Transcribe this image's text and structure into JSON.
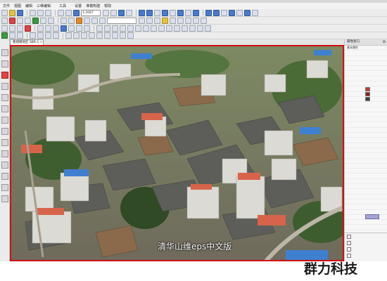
{
  "menu": [
    "文件",
    "视图",
    "编辑",
    "三维编辑",
    "",
    "工具",
    "",
    "设置",
    "准模构建",
    "帮助"
  ],
  "toolbar1": {
    "scale_value": "1:2087"
  },
  "doc_tab": {
    "label": "看建模地区 SBR-1"
  },
  "viewport": {
    "caption": "清华山维eps中文版"
  },
  "panel": {
    "title": "属性窗口",
    "rows": [
      {
        "key": "基本属性",
        "value": ""
      },
      {
        "key": "",
        "value": ""
      },
      {
        "key": "",
        "value": ""
      },
      {
        "key": "",
        "value": ""
      },
      {
        "key": "",
        "value": ""
      },
      {
        "key": "",
        "value": ""
      },
      {
        "key": "",
        "value": ""
      },
      {
        "key": "",
        "value": ""
      },
      {
        "key": "",
        "value": ""
      },
      {
        "key": "",
        "value": ""
      },
      {
        "key": "",
        "value": ""
      },
      {
        "key": "",
        "value": ""
      },
      {
        "key": "",
        "value": ""
      },
      {
        "key": "",
        "value": ""
      },
      {
        "key": "",
        "value": ""
      },
      {
        "key": "",
        "value": ""
      },
      {
        "key": "",
        "value": ""
      },
      {
        "key": "",
        "value": ""
      },
      {
        "key": "",
        "value": ""
      },
      {
        "key": "",
        "value": ""
      },
      {
        "key": "",
        "value": ""
      },
      {
        "key": "",
        "value": ""
      },
      {
        "key": "",
        "value": ""
      },
      {
        "key": "",
        "value": ""
      },
      {
        "key": "",
        "value": ""
      },
      {
        "key": "",
        "value": ""
      },
      {
        "key": "",
        "value": ""
      },
      {
        "key": "",
        "value": ""
      },
      {
        "key": "",
        "value": ""
      },
      {
        "key": "",
        "value": ""
      },
      {
        "key": "",
        "value": ""
      },
      {
        "key": "",
        "value": ""
      },
      {
        "key": "",
        "value": ""
      },
      {
        "key": "",
        "value": ""
      },
      {
        "key": "",
        "value": ""
      },
      {
        "key": "",
        "value": ""
      },
      {
        "key": "",
        "value": ""
      },
      {
        "key": "",
        "value": ""
      },
      {
        "key": "",
        "value": ""
      },
      {
        "key": "",
        "value": ""
      },
      {
        "key": "",
        "value": ""
      }
    ],
    "swatch_colors": [
      "#c0392b",
      "#8e1b1b",
      "#3b3b3b"
    ],
    "checkboxes": [
      "",
      "",
      "",
      "",
      "",
      "",
      "",
      "",
      "",
      "",
      "",
      "",
      "",
      "",
      "",
      "",
      "",
      "",
      ""
    ]
  },
  "brand": {
    "text": "群力科技"
  }
}
